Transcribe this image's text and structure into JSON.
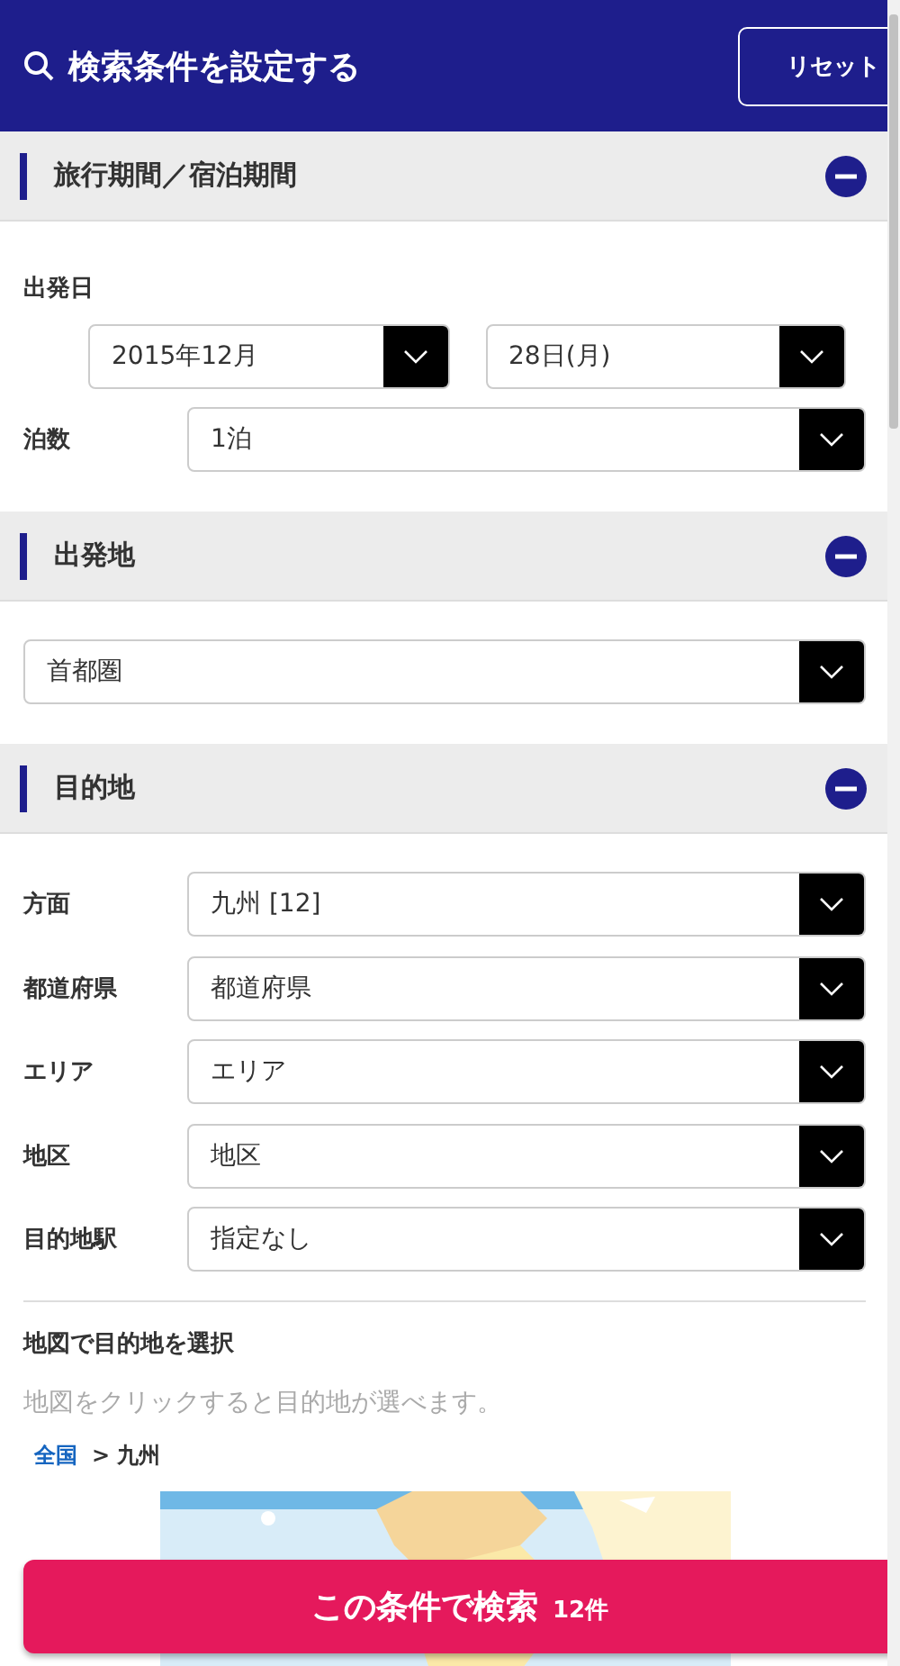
{
  "header": {
    "title": "検索条件を設定する",
    "reset_button": "リセット"
  },
  "sections": [
    {
      "title": "旅行期間／宿泊期間",
      "expanded": true,
      "date_label": "出発日",
      "date_selects": [
        "2015年12月",
        "28日(月)"
      ],
      "fields": [
        {
          "label": "泊数",
          "value": "1泊"
        }
      ]
    },
    {
      "title": "出発地",
      "expanded": true,
      "fields": [
        {
          "value": "首都圏"
        }
      ]
    },
    {
      "title": "目的地",
      "expanded": true,
      "fields": [
        {
          "label": "方面",
          "value": "九州 [12]"
        },
        {
          "label": "都道府県",
          "value": "都道府県"
        },
        {
          "label": "エリア",
          "value": "エリア"
        },
        {
          "label": "地区",
          "value": "地区"
        },
        {
          "label": "目的地駅",
          "value": "指定なし"
        }
      ],
      "map": {
        "title": "地図で目的地を選択",
        "hint": "地図をクリックすると目的地が選べます。",
        "breadcrumb": [
          {
            "kind": "link",
            "text": "全国"
          },
          {
            "kind": "current",
            "text": "> 九州"
          }
        ]
      }
    }
  ],
  "search_button": {
    "label": "この条件で検索",
    "count": "12件"
  }
}
